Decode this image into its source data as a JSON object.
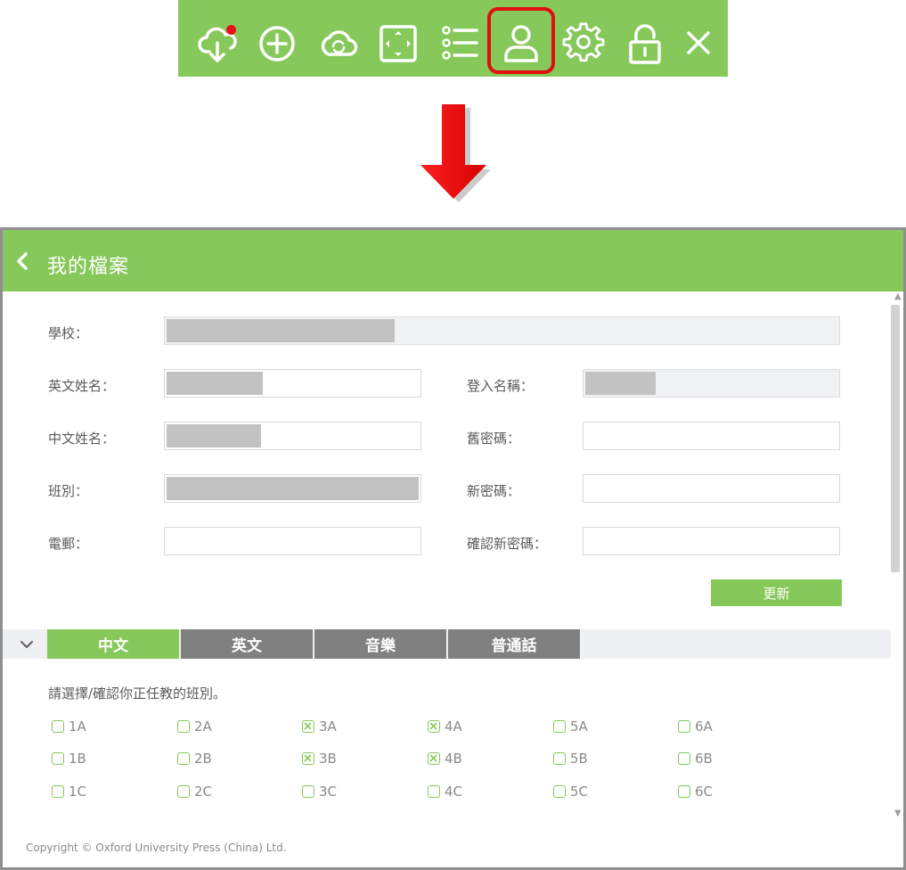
{
  "toolbar": {
    "buttons": [
      {
        "name": "cloud-download-icon"
      },
      {
        "name": "add-circle-icon"
      },
      {
        "name": "cloud-sync-icon"
      },
      {
        "name": "fullscreen-icon"
      },
      {
        "name": "list-icon"
      },
      {
        "name": "profile-icon",
        "active": true
      },
      {
        "name": "settings-gear-icon"
      },
      {
        "name": "unlock-icon"
      },
      {
        "name": "close-icon"
      }
    ],
    "notification_color": "#e8101c",
    "highlight_color": "#e01010"
  },
  "colors": {
    "accent": "#86c85a",
    "tab_inactive": "#808080",
    "arrow": "#e81414"
  },
  "profile": {
    "title": "我的檔案",
    "school_label": "學校：",
    "english_name_label": "英文姓名：",
    "chinese_name_label": "中文姓名：",
    "class_label": "班別：",
    "email_label": "電郵：",
    "login_name_label": "登入名稱：",
    "old_password_label": "舊密碼：",
    "new_password_label": "新密碼：",
    "confirm_password_label": "確認新密碼：",
    "update_button": "更新"
  },
  "subjects": {
    "tabs": [
      {
        "label": "中文",
        "active": true
      },
      {
        "label": "英文",
        "active": false
      },
      {
        "label": "音樂",
        "active": false
      },
      {
        "label": "普通話",
        "active": false
      }
    ],
    "instruction": "請選擇/確認你正任教的班別。",
    "classes": [
      [
        {
          "label": "1A",
          "checked": false
        },
        {
          "label": "2A",
          "checked": false
        },
        {
          "label": "3A",
          "checked": true
        },
        {
          "label": "4A",
          "checked": true
        },
        {
          "label": "5A",
          "checked": false
        },
        {
          "label": "6A",
          "checked": false
        }
      ],
      [
        {
          "label": "1B",
          "checked": false
        },
        {
          "label": "2B",
          "checked": false
        },
        {
          "label": "3B",
          "checked": true
        },
        {
          "label": "4B",
          "checked": true
        },
        {
          "label": "5B",
          "checked": false
        },
        {
          "label": "6B",
          "checked": false
        }
      ],
      [
        {
          "label": "1C",
          "checked": false
        },
        {
          "label": "2C",
          "checked": false
        },
        {
          "label": "3C",
          "checked": false
        },
        {
          "label": "4C",
          "checked": false
        },
        {
          "label": "5C",
          "checked": false
        },
        {
          "label": "6C",
          "checked": false
        }
      ]
    ]
  },
  "footer": {
    "copyright": "Copyright © Oxford University Press (China) Ltd."
  }
}
